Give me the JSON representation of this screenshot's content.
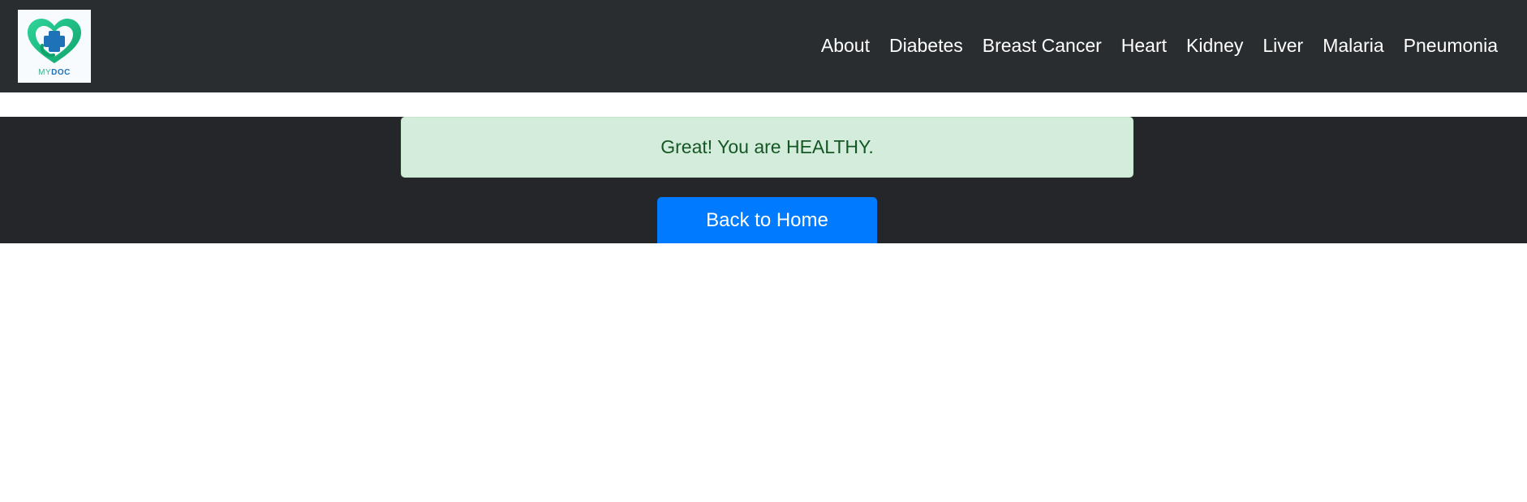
{
  "logo": {
    "text_my": "MY",
    "text_doc": "DOC",
    "colors": {
      "heart": "#1fbf83",
      "cross": "#1e72b8"
    }
  },
  "nav": {
    "items": [
      {
        "label": "About"
      },
      {
        "label": "Diabetes"
      },
      {
        "label": "Breast Cancer"
      },
      {
        "label": "Heart"
      },
      {
        "label": "Kidney"
      },
      {
        "label": "Liver"
      },
      {
        "label": "Malaria"
      },
      {
        "label": "Pneumonia"
      }
    ]
  },
  "result": {
    "message": "Great! You are HEALTHY.",
    "status_color": "#155724"
  },
  "actions": {
    "back_label": "Back to Home",
    "accent": "#007bff"
  }
}
